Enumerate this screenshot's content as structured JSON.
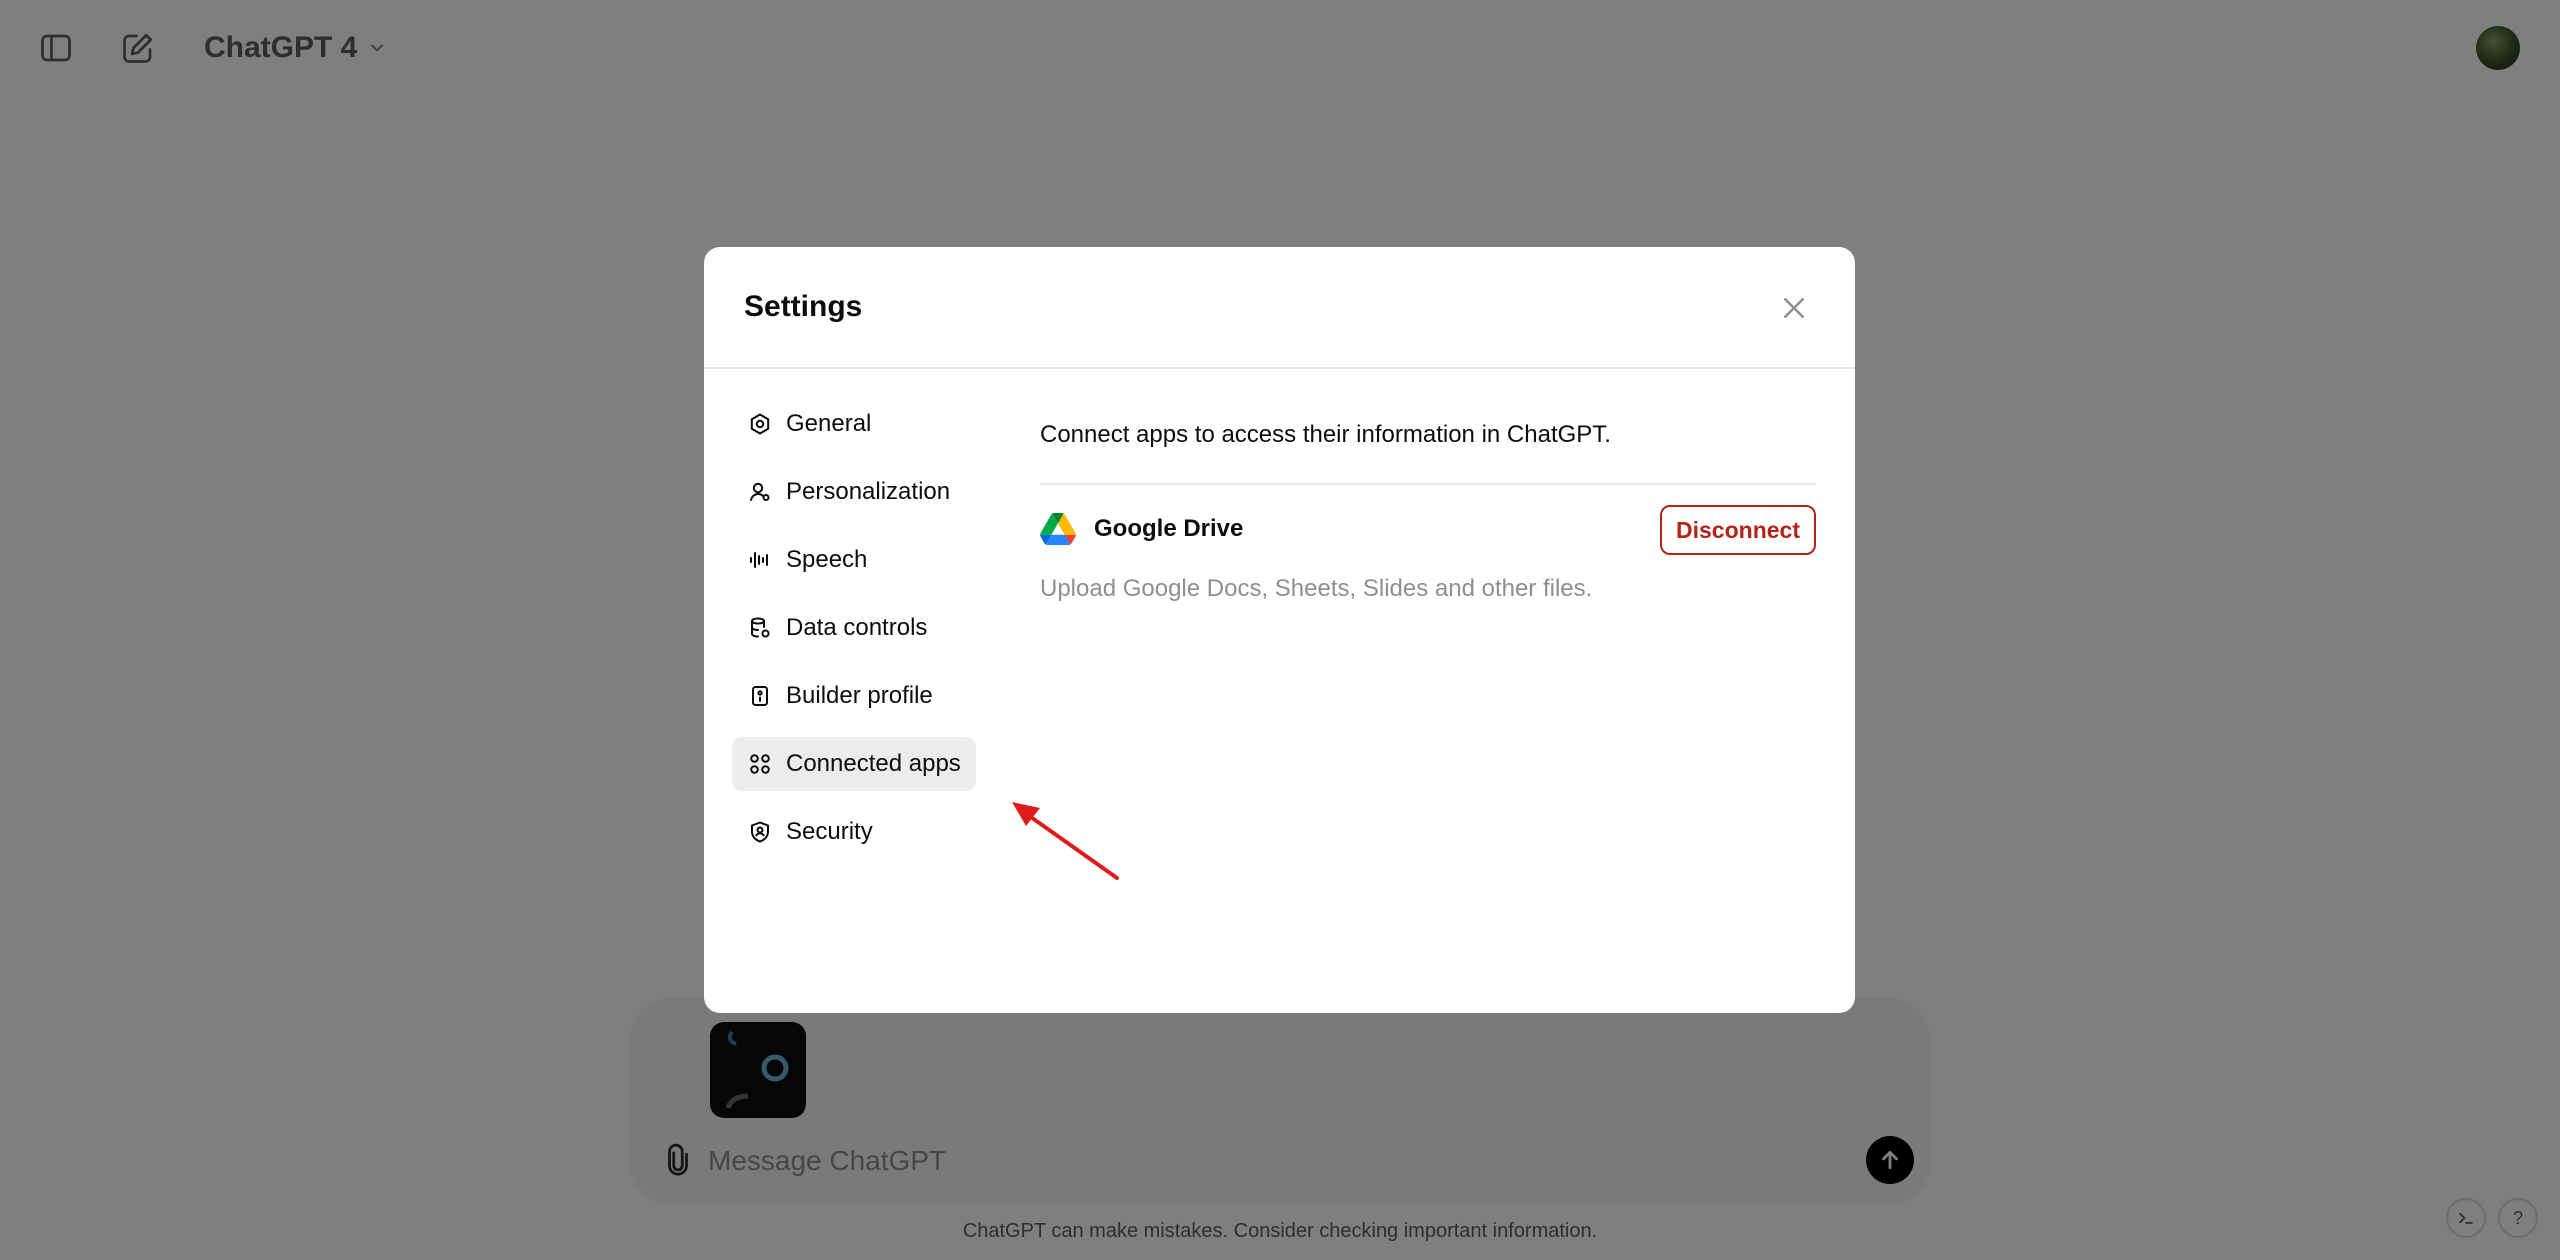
{
  "header": {
    "model_name": "ChatGPT 4"
  },
  "icons": {
    "sidebar_toggle": "sidebar-toggle-icon",
    "new_chat": "compose-icon",
    "model_dropdown": "chevron-down-icon",
    "attach": "paperclip-icon",
    "send": "arrow-up-icon",
    "close": "close-icon",
    "shell": "terminal-icon"
  },
  "composer": {
    "placeholder": "Message ChatGPT"
  },
  "footer": {
    "disclaimer": "ChatGPT can make mistakes. Consider checking important information.",
    "help_label": "?"
  },
  "settings": {
    "title": "Settings",
    "nav": [
      {
        "label": "General",
        "icon": "gear-icon"
      },
      {
        "label": "Personalization",
        "icon": "person-icon"
      },
      {
        "label": "Speech",
        "icon": "waveform-icon"
      },
      {
        "label": "Data controls",
        "icon": "database-icon"
      },
      {
        "label": "Builder profile",
        "icon": "id-card-icon"
      },
      {
        "label": "Connected apps",
        "icon": "apps-grid-icon",
        "active": true
      },
      {
        "label": "Security",
        "icon": "shield-icon"
      }
    ],
    "connected_apps": {
      "description": "Connect apps to access their information in ChatGPT.",
      "apps": [
        {
          "name": "Google Drive",
          "description": "Upload Google Docs, Sheets, Slides and other files.",
          "action_label": "Disconnect"
        }
      ]
    }
  },
  "colors": {
    "overlay": "#000000",
    "disconnect": "#b42318",
    "annotation_arrow": "#e01b1b",
    "active_nav_bg": "#ececec"
  }
}
